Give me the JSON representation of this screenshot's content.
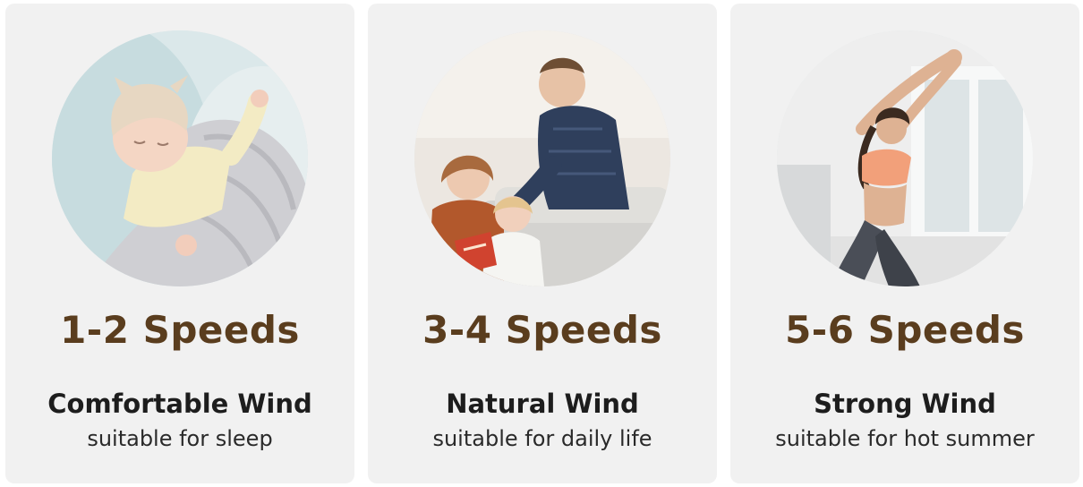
{
  "cards": [
    {
      "speeds": "1-2 Speeds",
      "mode": "Comfortable Wind",
      "description": "suitable for sleep",
      "image": "sleeping-baby-photo"
    },
    {
      "speeds": "3-4 Speeds",
      "mode": "Natural Wind",
      "description": "suitable for daily life",
      "image": "family-reading-photo"
    },
    {
      "speeds": "5-6 Speeds",
      "mode": "Strong Wind",
      "description": "suitable for hot summer",
      "image": "woman-stretching-photo"
    }
  ],
  "colors": {
    "speeds_text": "#5a3d1e",
    "card_background": "#f1f1f1"
  }
}
